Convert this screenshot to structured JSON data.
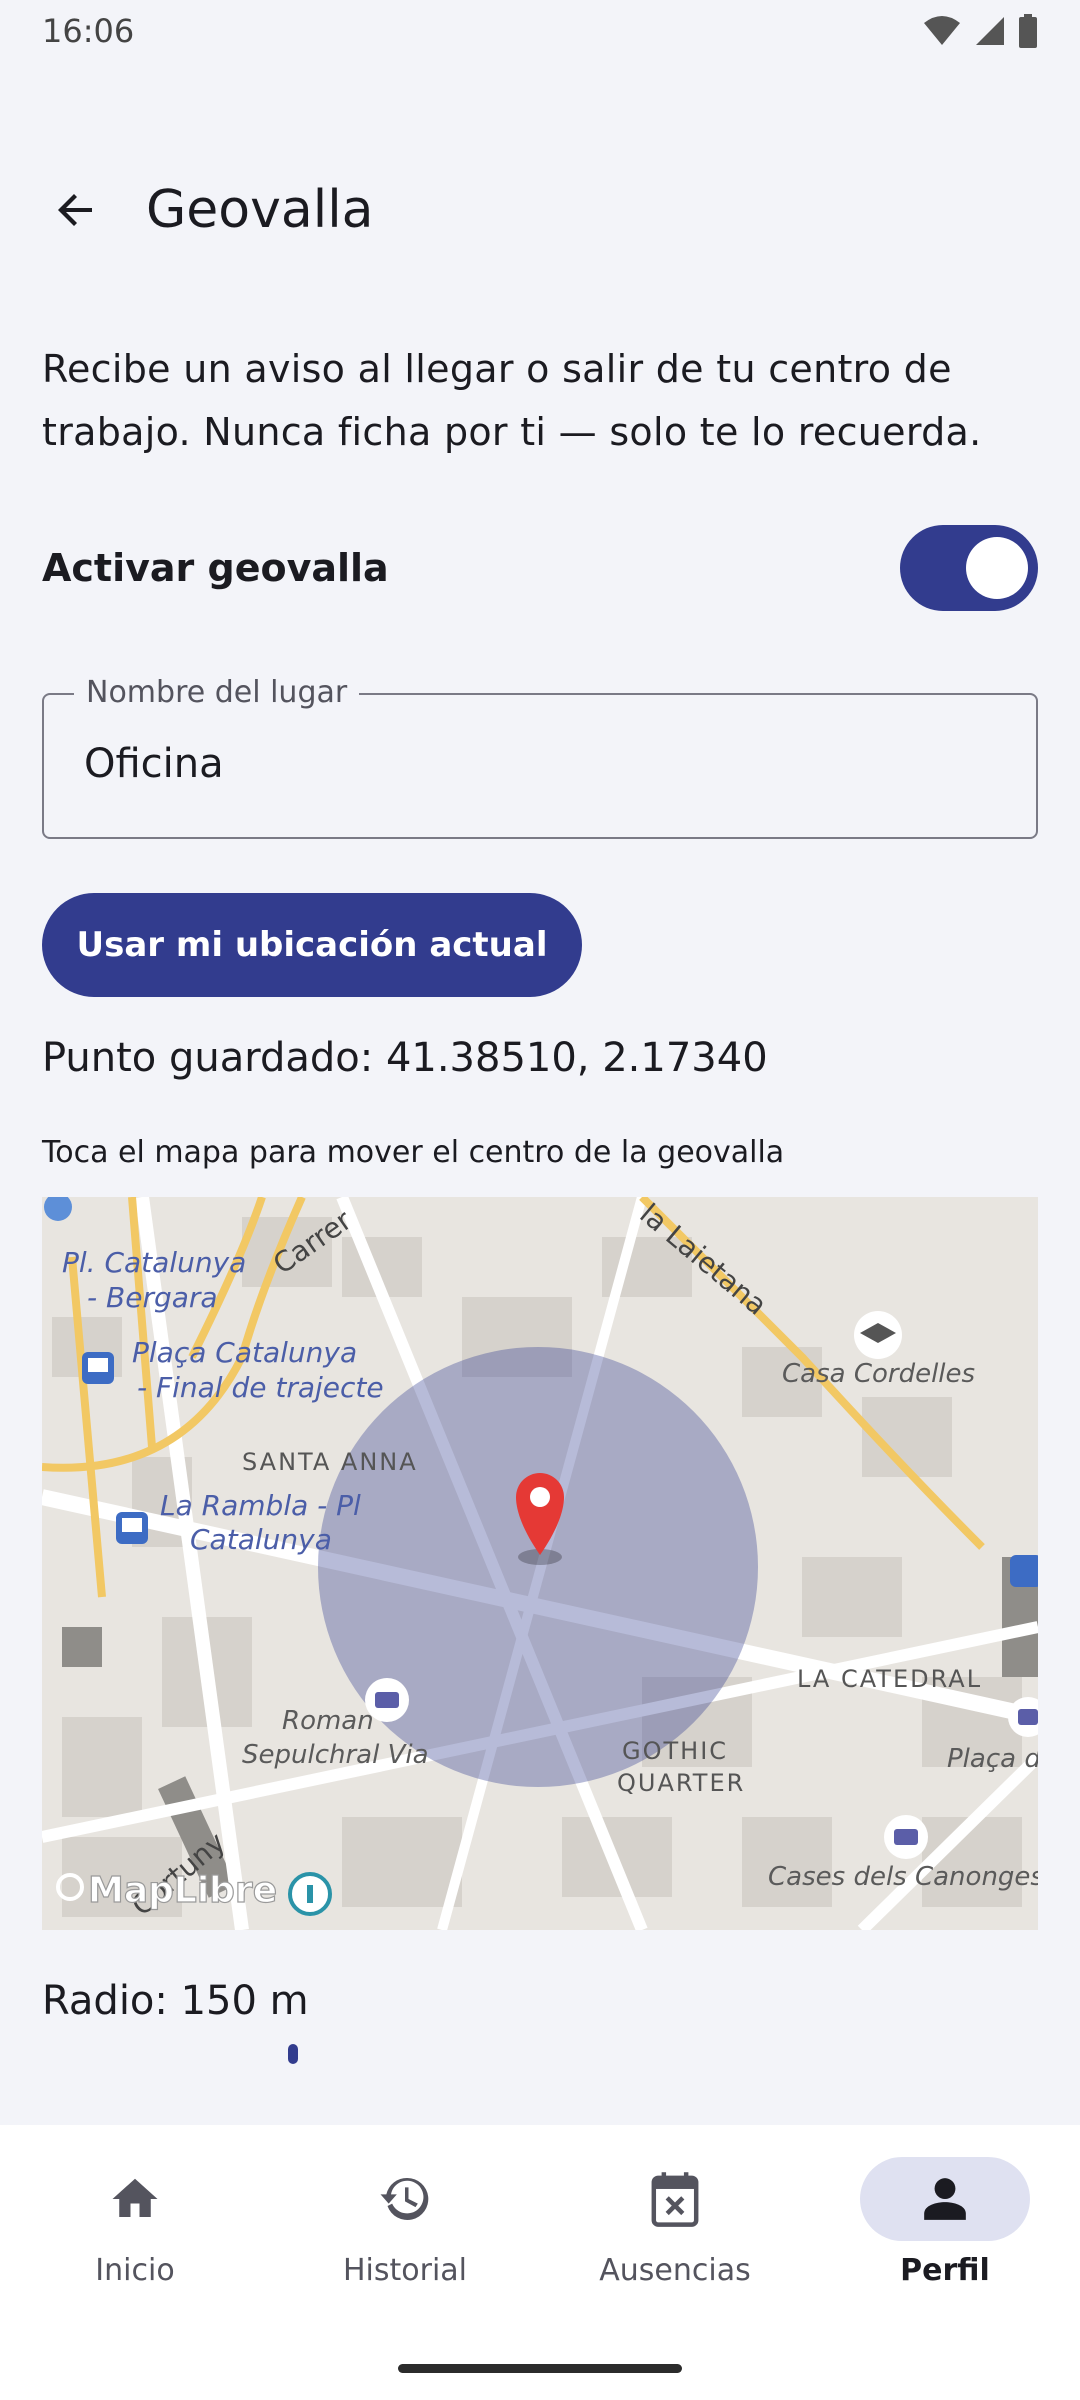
{
  "status_bar": {
    "time": "16:06"
  },
  "header": {
    "title": "Geovalla"
  },
  "description": "Recibe un aviso al llegar o salir de tu centro de trabajo. Nunca ficha por ti — solo te lo recuerda.",
  "toggle": {
    "label": "Activar geovalla",
    "enabled": true
  },
  "place_field": {
    "label": "Nombre del lugar",
    "value": "Oficina"
  },
  "use_location_button": "Usar mi ubicación actual",
  "saved_point": "Punto guardado: 41.38510, 2.17340",
  "map": {
    "hint": "Toca el mapa para mover el centro de la geovalla",
    "labels": {
      "pl_catalunya": "Pl. Catalunya",
      "bergara": "- Bergara",
      "carrer": "Carrer",
      "laietana": "la Laietana",
      "placa_cat_1": "Plaça Catalunya",
      "placa_cat_2": "- Final de trajecte",
      "casa_cordelles": "Casa Cordelles",
      "santa_anna": "SANTA ANNA",
      "rambla_1": "La Rambla - Pl",
      "rambla_2": "Catalunya",
      "la_catedral": "LA CATEDRAL",
      "roman_1": "Roman",
      "roman_2": "Sepulchral Via",
      "gothic_1": "GOTHIC",
      "gothic_2": "QUARTER",
      "placa_c": "Plaça d",
      "cortuny": "Cortuny",
      "cases": "Cases dels Canonges",
      "attribution": "MapLibre"
    },
    "accent_color": "#323c8e"
  },
  "radius": {
    "label": "Radio: 150 m",
    "value_m": 150
  },
  "nav": {
    "items": [
      {
        "label": "Inicio",
        "icon": "home-icon"
      },
      {
        "label": "Historial",
        "icon": "history-icon"
      },
      {
        "label": "Ausencias",
        "icon": "calendar-x-icon"
      },
      {
        "label": "Perfil",
        "icon": "person-icon",
        "active": true
      }
    ]
  }
}
